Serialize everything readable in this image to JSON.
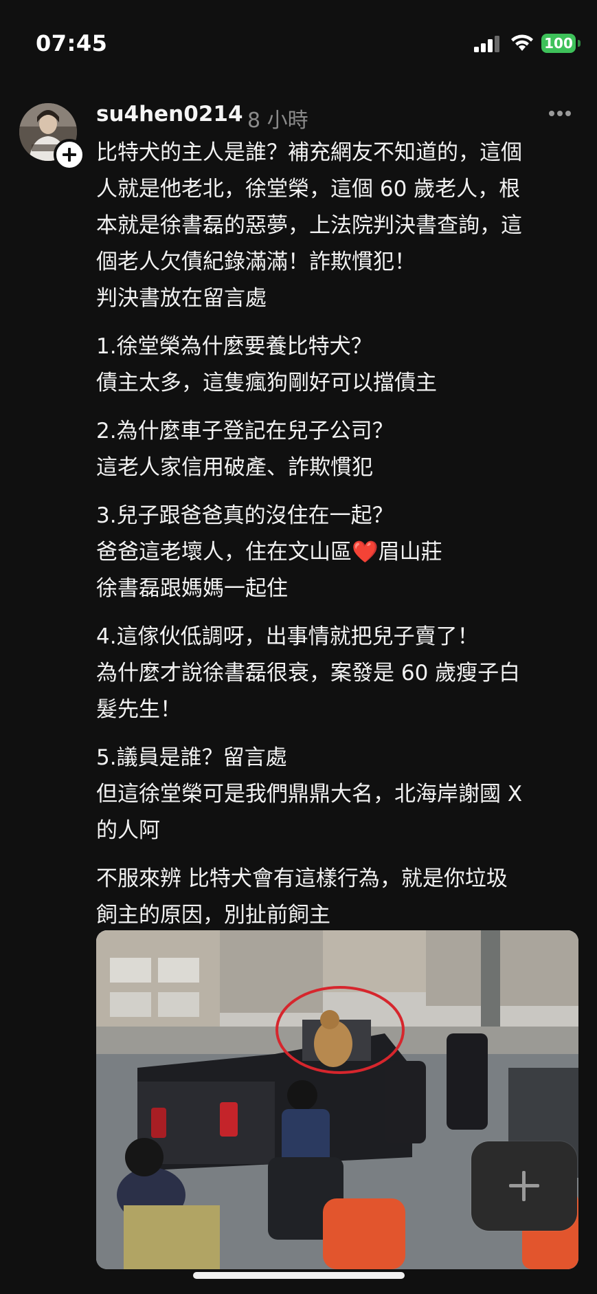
{
  "status_bar": {
    "time": "07:45",
    "battery": "100"
  },
  "post": {
    "username": "su4hen0214",
    "time_ago": "8 小時",
    "paragraphs": [
      [
        "比特犬的主人是誰？補充網友不知道的，這個",
        "人就是他老北，徐堂榮，這個 60 歲老人，根",
        "本就是徐書磊的惡夢，上法院判決書查詢，這",
        "個老人欠債紀錄滿滿！詐欺慣犯！",
        "判決書放在留言處"
      ],
      [
        "1.徐堂榮為什麼要養比特犬？",
        "債主太多，這隻瘋狗剛好可以擋債主"
      ],
      [
        "2.為什麼車子登記在兒子公司？",
        "這老人家信用破產、詐欺慣犯"
      ],
      [
        "3.兒子跟爸爸真的沒住在一起？"
      ],
      [
        "4.這傢伙低調呀，出事情就把兒子賣了！",
        "為什麼才說徐書磊很衰，案發是 60 歲瘦子白",
        "髮先生！"
      ],
      [
        "5.議員是誰？留言處",
        "但這徐堂榮可是我們鼎鼎大名，北海岸謝國 X",
        "的人阿"
      ],
      [
        "不服來辨  比特犬會有這樣行為，就是你垃圾",
        "飼主的原因，別扯前飼主"
      ]
    ],
    "p3_line2_before": "爸爸這老壞人，住在文山區",
    "p3_heart": "❤️",
    "p3_line2_after": "眉山莊",
    "p3_line3": "徐書磊跟媽媽一起住"
  },
  "icons": {
    "more": "more-horizontal-icon",
    "compose": "plus-icon",
    "follow": "follow-plus-icon"
  },
  "colors": {
    "background": "#101010",
    "text": "#f2f2f2",
    "muted": "#8b8b8b",
    "battery": "#3ec15a",
    "annotation_circle": "#d6262d"
  }
}
